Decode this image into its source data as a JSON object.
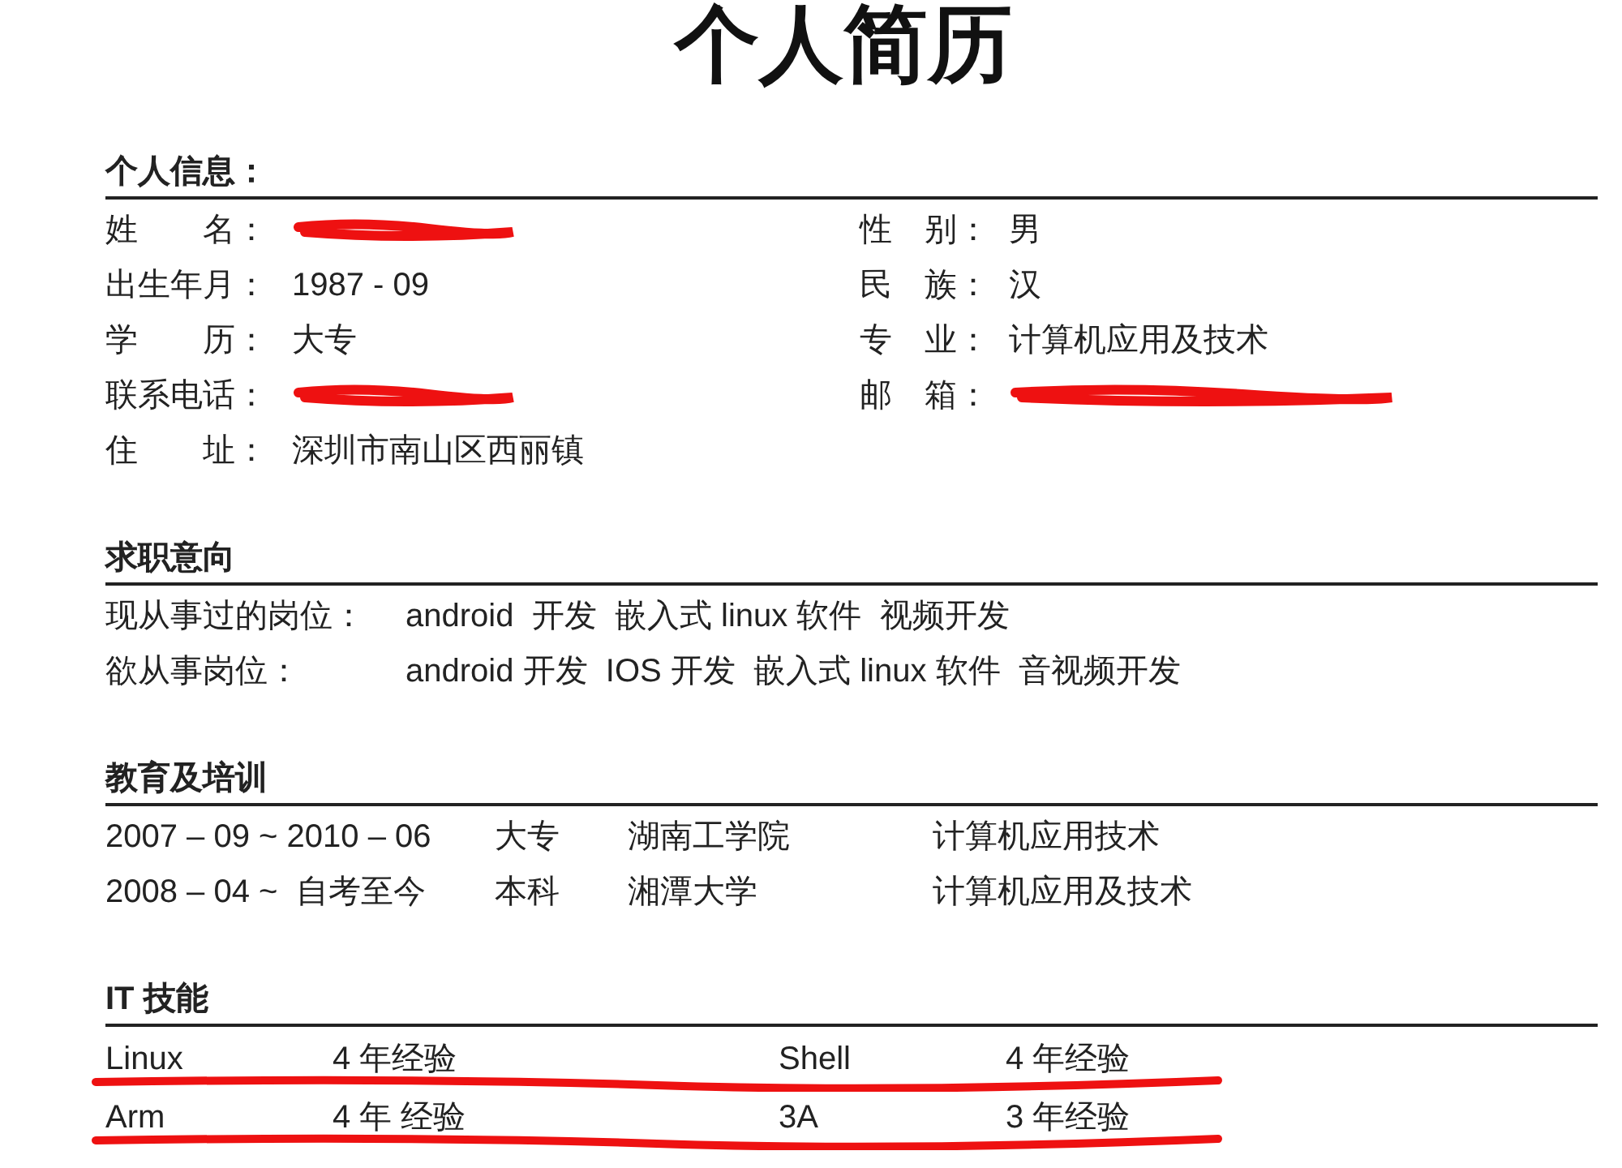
{
  "title": "个人简历",
  "personal": {
    "heading": "个人信息：",
    "rows": [
      [
        {
          "label": "姓　　名：",
          "redacted": true
        },
        {
          "label": "性　别：",
          "value": "男"
        }
      ],
      [
        {
          "label": "出生年月：",
          "value": "1987 - 09"
        },
        {
          "label": "民　族：",
          "value": "汉"
        }
      ],
      [
        {
          "label": "学　　历：",
          "value": "大专"
        },
        {
          "label": "专　业：",
          "value": "计算机应用及技术"
        }
      ],
      [
        {
          "label": "联系电话：",
          "redacted": true
        },
        {
          "label": "邮　箱：",
          "redacted": true
        }
      ],
      [
        {
          "label": "住　　址：",
          "value": "深圳市南山区西丽镇"
        }
      ]
    ]
  },
  "intention": {
    "heading": "求职意向",
    "rows": [
      {
        "label": "现从事过的岗位：",
        "value": "android  开发  嵌入式 linux 软件  视频开发"
      },
      {
        "label": "欲从事岗位：",
        "value": "android 开发  IOS 开发  嵌入式 linux 软件  音视频开发"
      }
    ]
  },
  "education": {
    "heading": "教育及培训",
    "rows": [
      [
        "2007 – 09 ~ 2010 – 06",
        "大专",
        "湖南工学院",
        "计算机应用技术"
      ],
      [
        "2008 – 04 ~  自考至今",
        "本科",
        "湘潭大学",
        "计算机应用及技术"
      ]
    ]
  },
  "skills": {
    "heading": "IT 技能",
    "rows": [
      {
        "cells": [
          "Linux",
          "4 年经验",
          "Shell",
          "4 年经验"
        ],
        "struck": true
      },
      {
        "cells": [
          "Arm",
          "4 年 经验",
          "3A",
          "3 年经验"
        ],
        "struck": true
      }
    ]
  }
}
